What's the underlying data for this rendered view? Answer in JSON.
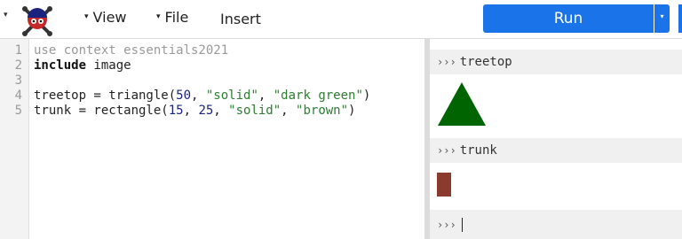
{
  "toolbar": {
    "logo_caret": "▾",
    "menus": [
      {
        "caret": "▾",
        "label": "View"
      },
      {
        "caret": "▾",
        "label": "File"
      }
    ],
    "insert_label": "Insert",
    "run_label": "Run",
    "run_dropdown": "▾"
  },
  "editor": {
    "line_numbers": [
      "1",
      "2",
      "3",
      "4",
      "5"
    ],
    "lines": [
      [
        {
          "t": "use context essentials2021",
          "c": "comment"
        }
      ],
      [
        {
          "t": "include",
          "c": "kw"
        },
        {
          "t": " image",
          "c": "plain"
        }
      ],
      [],
      [
        {
          "t": "treetop = triangle(",
          "c": "plain"
        },
        {
          "t": "50",
          "c": "num"
        },
        {
          "t": ", ",
          "c": "plain"
        },
        {
          "t": "\"solid\"",
          "c": "str"
        },
        {
          "t": ", ",
          "c": "plain"
        },
        {
          "t": "\"dark green\"",
          "c": "str"
        },
        {
          "t": ")",
          "c": "plain"
        }
      ],
      [
        {
          "t": "trunk = rectangle(",
          "c": "plain"
        },
        {
          "t": "15",
          "c": "num"
        },
        {
          "t": ", ",
          "c": "plain"
        },
        {
          "t": "25",
          "c": "num"
        },
        {
          "t": ", ",
          "c": "plain"
        },
        {
          "t": "\"solid\"",
          "c": "str"
        },
        {
          "t": ", ",
          "c": "plain"
        },
        {
          "t": "\"brown\"",
          "c": "str"
        },
        {
          "t": ")",
          "c": "plain"
        }
      ]
    ]
  },
  "repl": {
    "prompt_glyph": "›››",
    "entries": [
      {
        "expr": "treetop",
        "output": "triangle",
        "color": "#006400"
      },
      {
        "expr": "trunk",
        "output": "rectangle",
        "color": "#8b3a2e"
      }
    ],
    "current_input": ""
  },
  "colors": {
    "run_button": "#1a73e8",
    "treetop_fill": "#006400",
    "trunk_fill": "#8b3a2e"
  }
}
